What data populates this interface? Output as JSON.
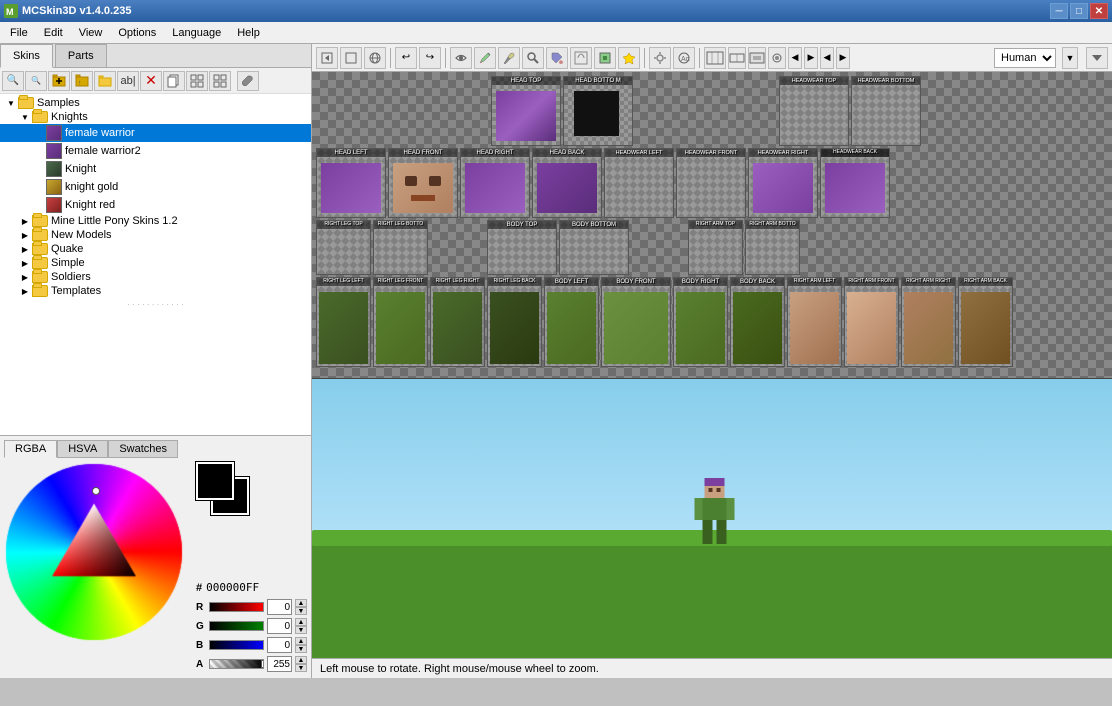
{
  "app": {
    "title": "MCSkin3D v1.4.0.235",
    "icon": "MC"
  },
  "title_controls": {
    "minimize": "─",
    "maximize": "□",
    "close": "✕"
  },
  "menu": {
    "items": [
      "File",
      "Edit",
      "View",
      "Options",
      "Language",
      "Help"
    ]
  },
  "tabs": {
    "skins_label": "Skins",
    "parts_label": "Parts"
  },
  "tree": {
    "items": [
      {
        "id": "samples",
        "label": "Samples",
        "type": "folder",
        "indent": 0,
        "expanded": true
      },
      {
        "id": "knights",
        "label": "Knights",
        "type": "folder",
        "indent": 1,
        "expanded": true
      },
      {
        "id": "female_warrior",
        "label": "female warrior",
        "type": "skin",
        "indent": 2,
        "selected": true
      },
      {
        "id": "female_warrior2",
        "label": "female warrior2",
        "type": "skin",
        "indent": 2
      },
      {
        "id": "knight",
        "label": "Knight",
        "type": "skin",
        "indent": 2
      },
      {
        "id": "knight_gold",
        "label": "knight gold",
        "type": "skin",
        "indent": 2
      },
      {
        "id": "knight_red",
        "label": "Knight red",
        "type": "skin",
        "indent": 2
      },
      {
        "id": "mine_little",
        "label": "Mine Little Pony Skins 1.2",
        "type": "folder",
        "indent": 1,
        "expanded": false
      },
      {
        "id": "new_models",
        "label": "New Models",
        "type": "folder",
        "indent": 1,
        "expanded": false
      },
      {
        "id": "quake",
        "label": "Quake",
        "type": "folder",
        "indent": 1,
        "expanded": false
      },
      {
        "id": "simple",
        "label": "Simple",
        "type": "folder",
        "indent": 1,
        "expanded": false
      },
      {
        "id": "soldiers",
        "label": "Soldiers",
        "type": "folder",
        "indent": 1,
        "expanded": false
      },
      {
        "id": "templates",
        "label": "Templates",
        "type": "folder",
        "indent": 1,
        "expanded": false
      }
    ]
  },
  "color_tabs": {
    "rgba": "RGBA",
    "hsva": "HSVA",
    "swatches": "Swatches"
  },
  "color": {
    "hex_label": "#",
    "hex_value": "000000FF",
    "r_label": "R",
    "r_value": "0",
    "g_label": "G",
    "g_value": "0",
    "b_label": "B",
    "b_value": "0",
    "a_label": "A",
    "a_value": "255"
  },
  "skin_panels": [
    {
      "label": "HEAD TOP"
    },
    {
      "label": "HEAD BOTTO M"
    },
    {
      "label": ""
    },
    {
      "label": ""
    },
    {
      "label": "HEADWEAR TOP"
    },
    {
      "label": "HEADWEAR BOTTOM"
    },
    {
      "label": ""
    },
    {
      "label": "HEAD LEFT"
    },
    {
      "label": "HEAD FRONT"
    },
    {
      "label": "HEAD RIGHT"
    },
    {
      "label": "HEAD BACK"
    },
    {
      "label": "HEADWEAR LEFT"
    },
    {
      "label": "HEADWEAR FRONT"
    },
    {
      "label": "HEADWEAR RIGHT"
    },
    {
      "label": "HEADWEAR BACK"
    },
    {
      "label": "RIGHT LEG TOP"
    },
    {
      "label": "RIGHT LEG BOTTO"
    },
    {
      "label": ""
    },
    {
      "label": "BODY TOP"
    },
    {
      "label": "BODY BOTTOM"
    },
    {
      "label": ""
    },
    {
      "label": "RIGHT ARM TOP"
    },
    {
      "label": "RIGHT ARM BOTTO"
    },
    {
      "label": "RIGHT LEG LEFT"
    },
    {
      "label": "RIGHT LEG FRONT"
    },
    {
      "label": "RIGHT LEG RIGHT"
    },
    {
      "label": "RIGHT LEG BACK"
    },
    {
      "label": "BODY LEFT"
    },
    {
      "label": "BODY FRONT"
    },
    {
      "label": "BODY RIGHT"
    },
    {
      "label": "BODY BACK"
    },
    {
      "label": "RIGHT ARM LEFT"
    },
    {
      "label": "RIGHT ARM FRONT"
    },
    {
      "label": "RIGHT ARM RIGHT"
    },
    {
      "label": "RIGHT ARM BACK"
    }
  ],
  "toolbar_right": {
    "view_options": [
      "Human"
    ],
    "selected_view": "Human"
  },
  "status": {
    "message": "Left mouse to rotate. Right mouse/mouse wheel to zoom."
  }
}
